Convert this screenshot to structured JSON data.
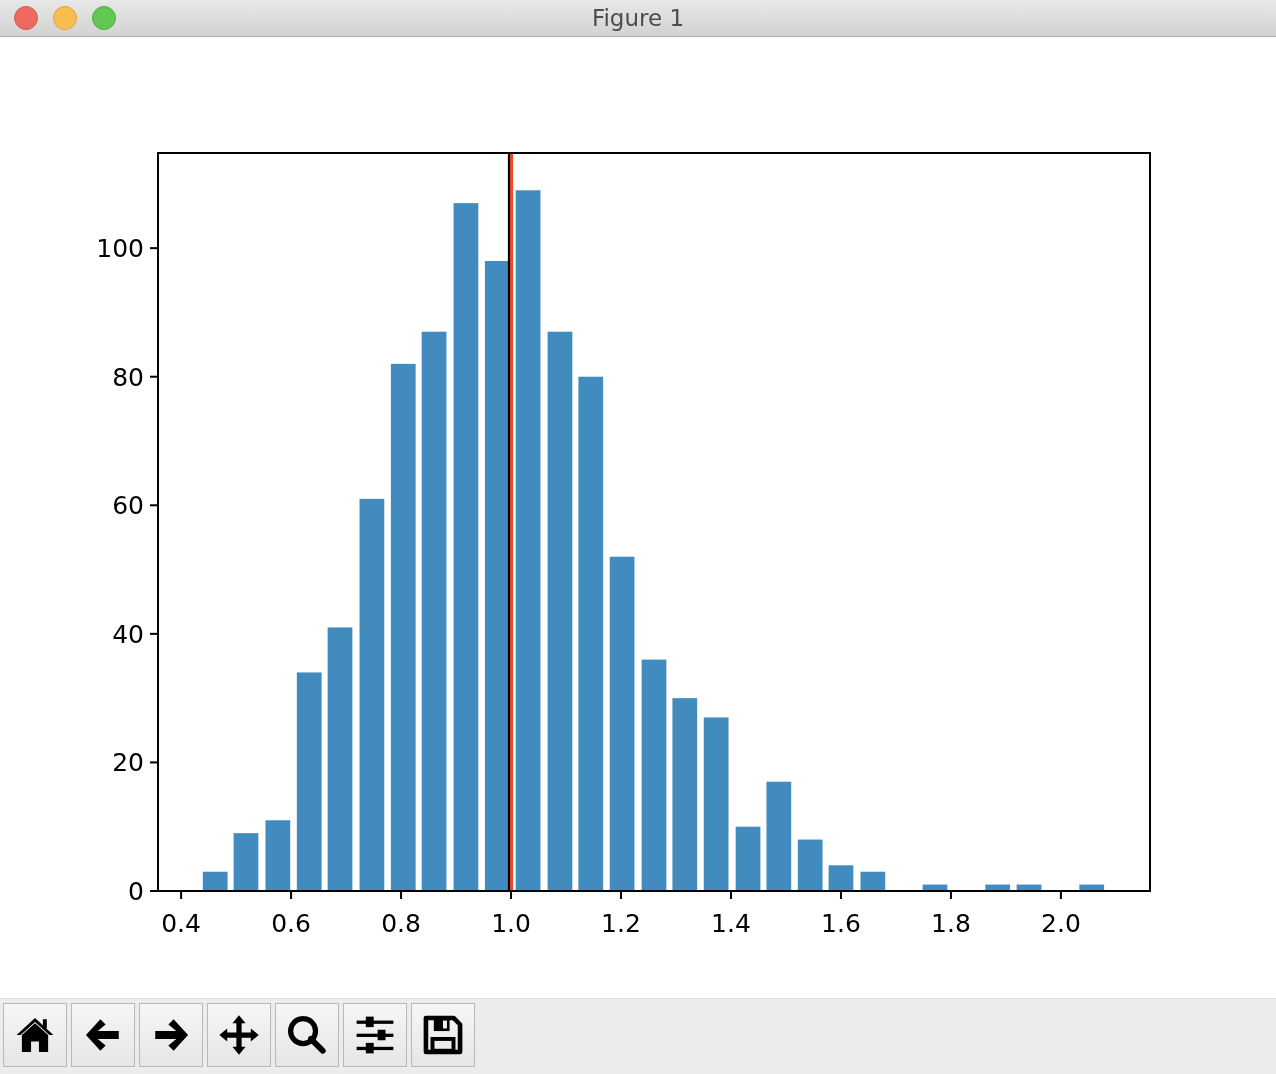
{
  "window": {
    "title": "Figure 1"
  },
  "figure": {
    "chart_data": {
      "type": "bar",
      "x": [
        0.462,
        0.518,
        0.576,
        0.633,
        0.689,
        0.747,
        0.804,
        0.86,
        0.918,
        0.975,
        1.031,
        1.089,
        1.145,
        1.202,
        1.26,
        1.316,
        1.373,
        1.431,
        1.487,
        1.544,
        1.6,
        1.658,
        1.771,
        1.885,
        1.942,
        2.056
      ],
      "series": [
        {
          "color": "#428bbe",
          "values": [
            3,
            9,
            11,
            34,
            41,
            61,
            82,
            87,
            107,
            98,
            109,
            87,
            80,
            52,
            36,
            30,
            27,
            10,
            17,
            8,
            4,
            3,
            1,
            1,
            1,
            1
          ]
        }
      ],
      "xlim": [
        0.358,
        2.162
      ],
      "ylim": [
        0,
        114.8
      ],
      "xticks": [
        {
          "value": 0.4,
          "label": "0.4"
        },
        {
          "value": 0.6,
          "label": "0.6"
        },
        {
          "value": 0.8,
          "label": "0.8"
        },
        {
          "value": 1.0,
          "label": "1.0"
        },
        {
          "value": 1.2,
          "label": "1.2"
        },
        {
          "value": 1.4,
          "label": "1.4"
        },
        {
          "value": 1.6,
          "label": "1.6"
        },
        {
          "value": 1.8,
          "label": "1.8"
        },
        {
          "value": 2.0,
          "label": "2.0"
        }
      ],
      "yticks": [
        {
          "value": 0,
          "label": "0"
        },
        {
          "value": 20,
          "label": "20"
        },
        {
          "value": 40,
          "label": "40"
        },
        {
          "value": 60,
          "label": "60"
        },
        {
          "value": 80,
          "label": "80"
        },
        {
          "value": 100,
          "label": "100"
        }
      ],
      "ref_lines": [
        {
          "axis": "x",
          "value": 0.997,
          "color": "#000000"
        },
        {
          "axis": "x",
          "value": 1.001,
          "color": "#f04a28"
        }
      ]
    }
  },
  "toolbar": [
    {
      "kind": "home"
    },
    {
      "kind": "back"
    },
    {
      "kind": "forward"
    },
    {
      "kind": "pan"
    },
    {
      "kind": "zoom"
    },
    {
      "kind": "configure"
    },
    {
      "kind": "save"
    }
  ]
}
